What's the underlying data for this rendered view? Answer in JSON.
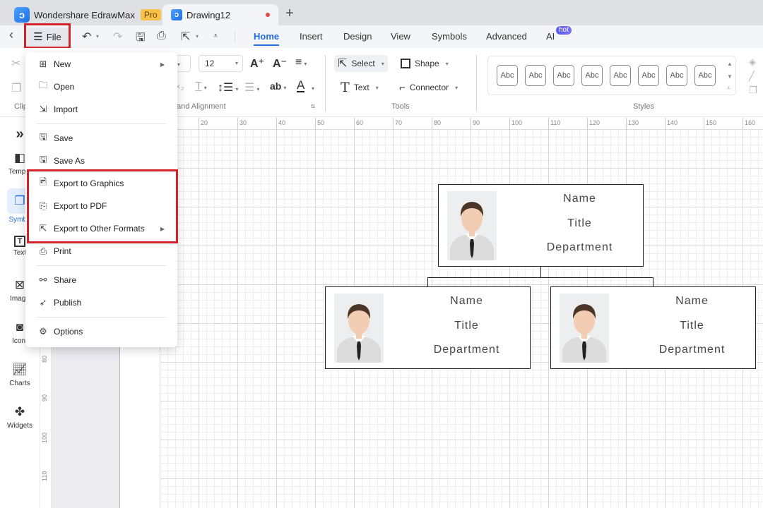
{
  "titlebar": {
    "app_name": "Wondershare EdrawMax",
    "pro_badge": "Pro",
    "doc_tab": "Drawing12",
    "new_tab_icon": "+"
  },
  "toolbar": {
    "file_label": "File",
    "tabs": [
      {
        "label": "Home",
        "active": true
      },
      {
        "label": "Insert"
      },
      {
        "label": "Design"
      },
      {
        "label": "View"
      },
      {
        "label": "Symbols"
      },
      {
        "label": "Advanced"
      },
      {
        "label": "AI"
      }
    ],
    "ai_badge": "hot"
  },
  "ribbon": {
    "font_size": "12",
    "groups": {
      "clipboard": "Clip",
      "font_alignment": "and Alignment",
      "tools": "Tools",
      "styles": "Styles"
    },
    "tools": {
      "select": "Select",
      "shape": "Shape",
      "text": "Text",
      "connector": "Connector"
    },
    "style_swatches": [
      "Abc",
      "Abc",
      "Abc",
      "Abc",
      "Abc",
      "Abc",
      "Abc",
      "Abc"
    ],
    "text_ab": "ab"
  },
  "sidebar": {
    "items": [
      {
        "label": "Templa",
        "icon": "templates-icon"
      },
      {
        "label": "Symbo",
        "icon": "symbols-icon",
        "active": true
      },
      {
        "label": "Text",
        "icon": "text-icon"
      },
      {
        "label": "Image",
        "icon": "image-icon"
      },
      {
        "label": "Icon.",
        "icon": "icons-icon"
      },
      {
        "label": "Charts",
        "icon": "charts-icon"
      },
      {
        "label": "Widgets",
        "icon": "widgets-icon"
      }
    ]
  },
  "file_menu": {
    "items": [
      {
        "label": "New",
        "icon": "new-icon",
        "submenu": true
      },
      {
        "label": "Open",
        "icon": "folder-icon"
      },
      {
        "label": "Import",
        "icon": "import-icon"
      },
      {
        "label": "Save",
        "icon": "save-icon"
      },
      {
        "label": "Save As",
        "icon": "save-as-icon"
      },
      {
        "label": "Export to Graphics",
        "icon": "export-graphics-icon"
      },
      {
        "label": "Export to PDF",
        "icon": "export-pdf-icon"
      },
      {
        "label": "Export to Other Formats",
        "icon": "export-other-icon",
        "submenu": true
      },
      {
        "label": "Print",
        "icon": "print-icon"
      },
      {
        "label": "Share",
        "icon": "share-icon"
      },
      {
        "label": "Publish",
        "icon": "publish-icon"
      },
      {
        "label": "Options",
        "icon": "gear-icon"
      }
    ]
  },
  "rulers": {
    "horizontal": [
      "20",
      "30",
      "40",
      "50",
      "60",
      "70",
      "80",
      "90",
      "100",
      "110",
      "120",
      "130",
      "140",
      "150",
      "160"
    ],
    "vertical": [
      "80",
      "90",
      "100",
      "110"
    ]
  },
  "org_chart": {
    "nodes": [
      {
        "name": "Name",
        "title": "Title",
        "department": "Department"
      },
      {
        "name": "Name",
        "title": "Title",
        "department": "Department"
      },
      {
        "name": "Name",
        "title": "Title",
        "department": "Department"
      }
    ]
  },
  "colors": {
    "accent": "#1f6fe0",
    "highlight_red": "#d3232a",
    "pro_badge": "#f8c14a",
    "hot_badge": "#5a5cf0"
  }
}
